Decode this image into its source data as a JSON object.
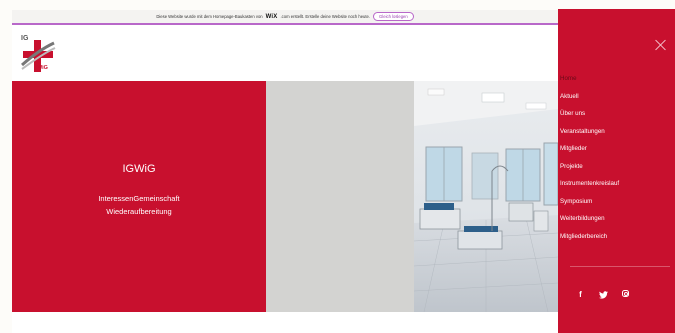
{
  "banner": {
    "text_before": "Diese Website wurde mit dem Homepage-Baukasten von",
    "brand": "WiX",
    "text_after": ".com erstellt. Erstelle deine Website noch heute.",
    "cta_label": "Gleich loslegen"
  },
  "logo": {
    "top_text": "IG",
    "bottom_text": "WiG"
  },
  "hero": {
    "title": "IGWiG",
    "subtitle_line1": "InteressenGemeinschaft",
    "subtitle_line2": "Wiederaufbereitung"
  },
  "menu": {
    "items": [
      {
        "label": "Home",
        "active": true
      },
      {
        "label": "Aktuell"
      },
      {
        "label": "Über uns"
      },
      {
        "label": "Veranstaltungen"
      },
      {
        "label": "Mitglieder"
      },
      {
        "label": "Projekte"
      },
      {
        "label": "Instrumentenkreislauf"
      },
      {
        "label": "Symposium"
      },
      {
        "label": "Weiterbildungen"
      },
      {
        "label": "Mitgliederbereich"
      }
    ],
    "social": [
      "facebook-icon",
      "twitter-icon",
      "instagram-icon"
    ]
  },
  "colors": {
    "brand_red": "#c8102e",
    "wix_accent": "#b868c9",
    "panel_grey": "#d3d3d1"
  }
}
